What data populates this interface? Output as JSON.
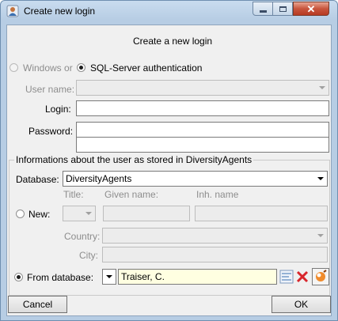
{
  "window": {
    "title": "Create new login"
  },
  "heading": "Create a new login",
  "auth": {
    "windows_label": "Windows or",
    "sql_label": "SQL-Server authentication"
  },
  "fields": {
    "user_name_label": "User name:",
    "login_label": "Login:",
    "login_value": "",
    "password_label": "Password:",
    "password_value": "",
    "password_confirm_value": ""
  },
  "agents_group": {
    "title": "Informations about the user as stored in DiversityAgents",
    "database_label": "Database:",
    "database_value": "DiversityAgents",
    "new_label": "New:",
    "title_label": "Title:",
    "given_name_label": "Given name:",
    "inh_name_label": "Inh. name",
    "country_label": "Country:",
    "city_label": "City:",
    "from_database_label": "From database:",
    "from_database_value": "Traiser, C."
  },
  "buttons": {
    "cancel": "Cancel",
    "ok": "OK"
  },
  "colors": {
    "highlight_field": "#ffffe1",
    "delete_red": "#d8262c"
  }
}
